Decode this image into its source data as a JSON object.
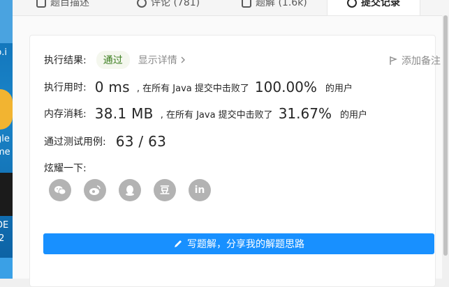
{
  "desktop": {
    "items": [
      {
        "label": "p.i"
      },
      {
        "label": "gle"
      },
      {
        "label": "me"
      },
      {
        "label": "DE"
      },
      {
        "label": ".2"
      }
    ]
  },
  "tabs": [
    {
      "label": "题目描述",
      "icon": "document-icon"
    },
    {
      "label": "评论 (781)",
      "icon": "comment-icon"
    },
    {
      "label": "题解 (1.6k)",
      "icon": "flask-icon"
    },
    {
      "label": "提交记录",
      "icon": "clock-icon",
      "active": true
    }
  ],
  "result": {
    "status_label": "执行结果:",
    "status_badge": "通过",
    "detail_link": "显示详情",
    "add_note": "添加备注",
    "time_label": "执行用时:",
    "time_value": "0 ms",
    "time_text": ", 在所有 Java 提交中击败了",
    "time_percent": "100.00%",
    "time_suffix": "的用户",
    "memory_label": "内存消耗:",
    "memory_value": "38.1 MB",
    "memory_text": ", 在所有 Java 提交中击败了",
    "memory_percent": "31.67%",
    "memory_suffix": "的用户",
    "tests_label": "通过测试用例:",
    "tests_value": "63 / 63",
    "share_label": "炫耀一下:"
  },
  "share_icons": [
    "wechat-icon",
    "weibo-icon",
    "qq-icon",
    "douban-icon",
    "linkedin-icon"
  ],
  "share_glyphs": [
    "",
    "",
    "",
    "豆",
    "in"
  ],
  "write_solution_label": "写题解，分享我的解题思路",
  "colors": {
    "primary": "#1890ff",
    "pass_green": "#3a7d1e",
    "share_gray": "#b3b3b3"
  }
}
